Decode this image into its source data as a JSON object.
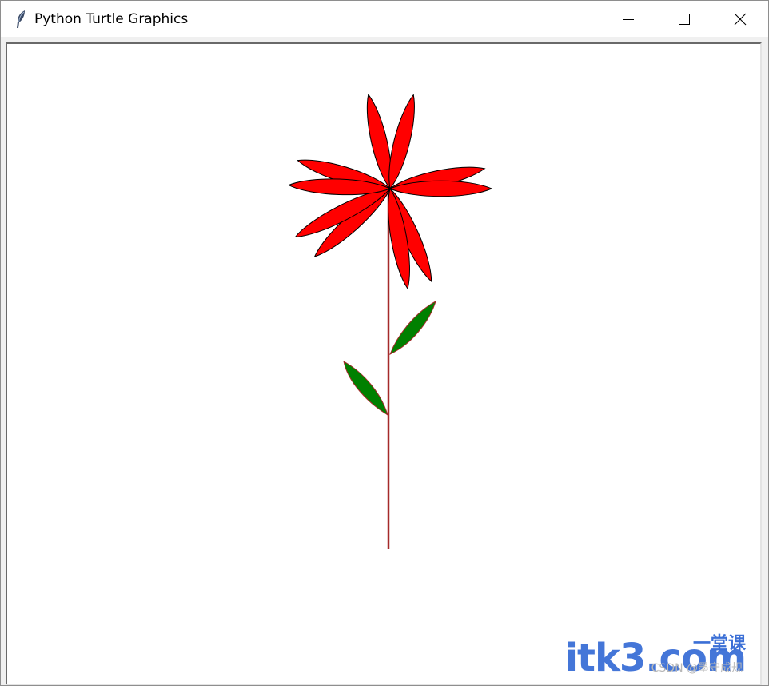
{
  "window": {
    "title": "Python Turtle Graphics",
    "icon": "feather-icon",
    "controls": {
      "minimize": "minimize-icon",
      "maximize": "maximize-icon",
      "close": "close-icon"
    }
  },
  "canvas": {
    "background": "#ffffff",
    "drawing": {
      "petal_fill": "#ff0000",
      "petal_outline": "#000000",
      "stem_color": "#a52a2a",
      "leaf_fill": "#008000",
      "leaf_outline": "#a52a2a"
    }
  },
  "watermark": {
    "brand": "itk3.com",
    "brand_cn": "一堂课",
    "small": "CSDN @墨守成规"
  }
}
